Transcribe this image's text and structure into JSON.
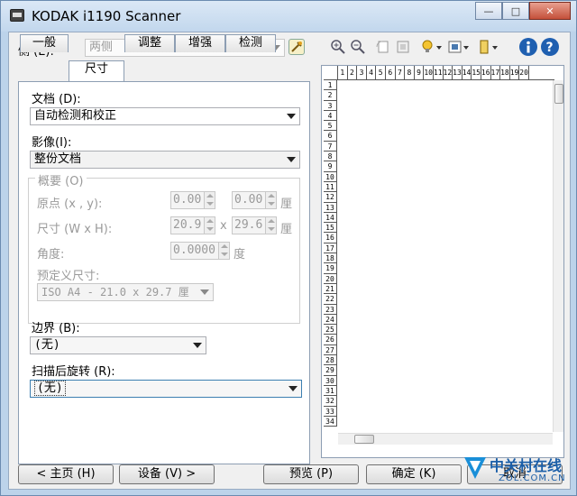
{
  "window": {
    "title": "KODAK i1190 Scanner",
    "min_symbol": "—",
    "max_symbol": "□",
    "close_symbol": "✕"
  },
  "toolbar": {
    "side_label": "侧 (E):",
    "side_value": "两侧"
  },
  "tabs": [
    {
      "label": "一般"
    },
    {
      "label": "尺寸"
    },
    {
      "label": "调整"
    },
    {
      "label": "增强"
    },
    {
      "label": "检测"
    }
  ],
  "size_tab": {
    "document_label": "文档 (D):",
    "document_value": "自动检测和校正",
    "image_label": "影像(I):",
    "image_value": "整份文档",
    "outline_group_label": "概要 (O)",
    "origin_label": "原点 (x , y):",
    "origin_x": "0.00",
    "origin_y": "0.00",
    "origin_unit": "厘",
    "size_label": "尺寸 (W x H):",
    "width": "20.9",
    "height": "29.6",
    "size_sep": "x",
    "size_unit": "厘",
    "angle_label": "角度:",
    "angle_value": "0.0000",
    "angle_unit": "度",
    "predefined_label": "预定义尺寸:",
    "predefined_value": "ISO A4 - 21.0 x 29.7 厘",
    "border_label": "边界 (B):",
    "border_value": "(无)",
    "rotation_label": "扫描后旋转 (R):",
    "rotation_value": "(无)"
  },
  "preview": {
    "h_ruler": [
      "1",
      "2",
      "3",
      "4",
      "5",
      "6",
      "7",
      "8",
      "9",
      "10",
      "11",
      "12",
      "13",
      "14",
      "15",
      "16",
      "17",
      "18",
      "19",
      "20"
    ],
    "v_ruler": [
      "1",
      "2",
      "3",
      "4",
      "5",
      "6",
      "7",
      "8",
      "9",
      "10",
      "11",
      "12",
      "13",
      "14",
      "15",
      "16",
      "17",
      "18",
      "19",
      "20",
      "21",
      "22",
      "23",
      "24",
      "25",
      "26",
      "27",
      "28",
      "29",
      "30",
      "31",
      "32",
      "33",
      "34"
    ]
  },
  "buttons": {
    "home": "< 主页 (H)",
    "device": "设备 (V) >",
    "preview": "预览 (P)",
    "ok": "确定 (K)",
    "cancel": "取消"
  },
  "watermark": {
    "brand": "中关村在线",
    "url": "ZOL.COM.CN"
  }
}
